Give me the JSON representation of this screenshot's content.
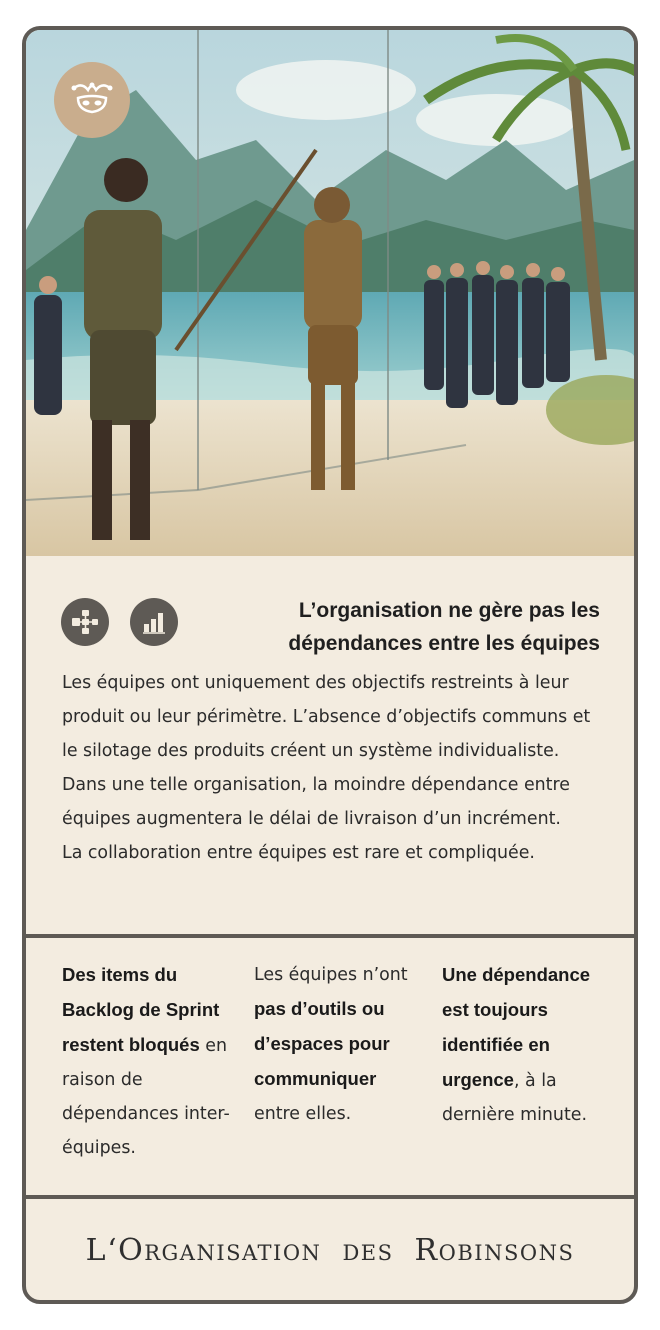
{
  "card": {
    "title": "L’organisation ne gère pas les dépendances entre les équipes",
    "description": [
      "Les équipes ont uniquement des objectifs restreints à leur produit ou leur périmètre. L’absence d’objectifs communs et le silotage des produits créent un système individualiste. Dans une telle organisation, la moindre dépendance entre équipes augmentera le délai de livraison d’un incrément.",
      "La collaboration entre équipes est rare et compliquée."
    ],
    "symptoms": [
      {
        "bold_lead": "Des items du Backlog de Sprint restent bloqués",
        "text_after": " en raison de dépendances inter-équipes."
      },
      {
        "text_before": "Les équipes n’ont ",
        "bold": "pas d’outils ou d’espaces pour communiquer",
        "text_after": " entre elles."
      },
      {
        "bold_lead": "Une dépendance est toujours identifiée en urgence",
        "text_after": ", à la dernière minute."
      }
    ],
    "footer_title": "L‘Organisation des Robinsons",
    "badge_icon": "jester-mask-icon",
    "category_icons": [
      "hierarchy-network-icon",
      "bar-chart-icon"
    ],
    "colors": {
      "border": "#5e5a55",
      "background": "#f3ece0",
      "badge": "#c9ad8d",
      "icon_circle": "#5e5a55"
    }
  }
}
